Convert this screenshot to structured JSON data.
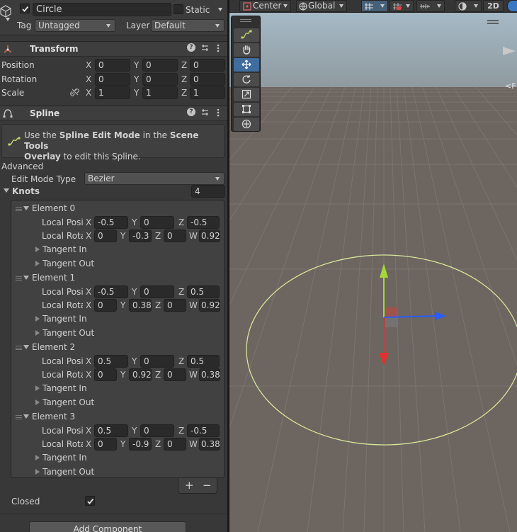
{
  "object": {
    "name": "Circle",
    "static_label": "Static",
    "tag_label": "Tag",
    "tag_value": "Untagged",
    "layer_label": "Layer",
    "layer_value": "Default"
  },
  "transform": {
    "title": "Transform",
    "rows": [
      {
        "label": "Position",
        "x": "0",
        "y": "0",
        "z": "0"
      },
      {
        "label": "Rotation",
        "x": "0",
        "y": "0",
        "z": "0"
      },
      {
        "label": "Scale",
        "x": "1",
        "y": "1",
        "z": "1"
      }
    ]
  },
  "spline": {
    "title": "Spline",
    "info_pre": "Use the ",
    "info_bold1": "Spline Edit Mode",
    "info_mid": " in the ",
    "info_bold2": "Scene Tools",
    "info_bold3": "Overlay",
    "info_post": " to edit this Spline.",
    "advanced_label": "Advanced",
    "edit_mode_label": "Edit Mode Type",
    "edit_mode_value": "Bezier",
    "knots_label": "Knots",
    "knots_count": "4",
    "pos_label": "Local Posi",
    "rot_label": "Local Rota",
    "tangent_in_label": "Tangent In",
    "tangent_out_label": "Tangent Out",
    "elements": [
      {
        "label": "Element 0",
        "px": "-0.5",
        "py": "0",
        "pz": "-0.5",
        "rx": "0",
        "ry": "-0.3",
        "rz": "0",
        "rw": "0.92"
      },
      {
        "label": "Element 1",
        "px": "-0.5",
        "py": "0",
        "pz": "0.5",
        "rx": "0",
        "ry": "0.38",
        "rz": "0",
        "rw": "0.92"
      },
      {
        "label": "Element 2",
        "px": "0.5",
        "py": "0",
        "pz": "0.5",
        "rx": "0",
        "ry": "0.92",
        "rz": "0",
        "rw": "0.38"
      },
      {
        "label": "Element 3",
        "px": "0.5",
        "py": "0",
        "pz": "-0.5",
        "rx": "0",
        "ry": "-0.9",
        "rz": "0",
        "rw": "0.38"
      }
    ],
    "add_label": "+",
    "remove_label": "−",
    "closed_label": "Closed",
    "closed": true
  },
  "add_component_label": "Add Component",
  "scene_toolbar": {
    "pivot_label": "Center",
    "space_label": "Global",
    "mode_2d_label": "2D"
  },
  "scene_tools": [
    "spline-tool",
    "hand-tool",
    "move-tool",
    "rotate-tool",
    "scale-tool",
    "rect-tool",
    "transform-tool"
  ],
  "colors": {
    "accent": "#2c5d87",
    "spline": "#d8e89a",
    "x_axis": "#2a5cff",
    "y_axis": "#b6e33b",
    "z_axis": "#e83a3a"
  }
}
